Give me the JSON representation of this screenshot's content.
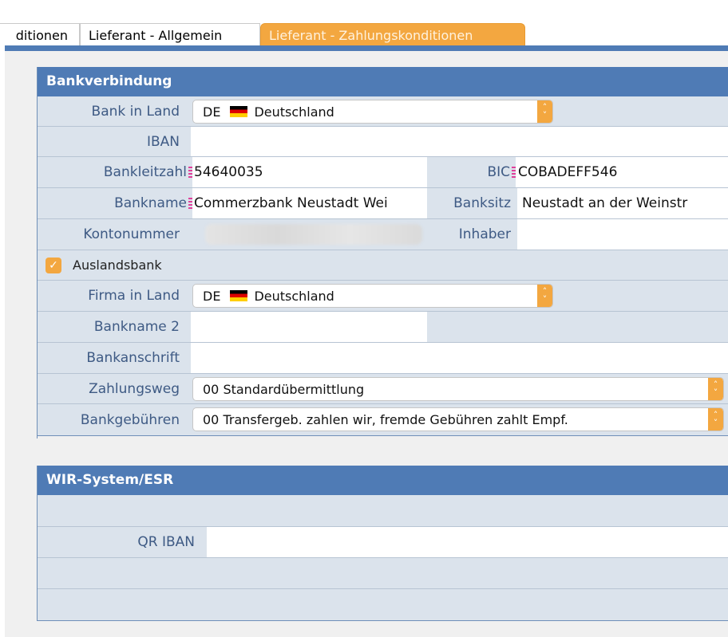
{
  "tabs": [
    {
      "label": "ditionen",
      "active": false
    },
    {
      "label": "Lieferant - Allgemein",
      "active": false
    },
    {
      "label": "Lieferant - Zahlungskonditionen",
      "active": true
    }
  ],
  "colors": {
    "accent": "#f3a740",
    "header": "#4f7bb5",
    "label": "#3e5a84",
    "row": "#dbe3ec"
  },
  "bank_panel": {
    "title": "Bankverbindung",
    "bank_in_land": {
      "label": "Bank in Land",
      "code": "DE",
      "country": "Deutschland"
    },
    "iban": {
      "label": "IBAN",
      "value": ""
    },
    "bankleitzahl": {
      "label": "Bankleitzahl",
      "value": "54640035"
    },
    "bic": {
      "label": "BIC",
      "value": "COBADEFF546"
    },
    "bankname": {
      "label": "Bankname",
      "value": "Commerzbank Neustadt Wei"
    },
    "banksitz": {
      "label": "Banksitz",
      "value": "Neustadt an der Weinstr"
    },
    "kontonummer": {
      "label": "Kontonummer"
    },
    "inhaber": {
      "label": "Inhaber",
      "value": ""
    },
    "auslandsbank": {
      "label": "Auslandsbank",
      "checked": true
    },
    "firma_in_land": {
      "label": "Firma in Land",
      "code": "DE",
      "country": "Deutschland"
    },
    "bankname2": {
      "label": "Bankname 2",
      "value": ""
    },
    "bankanschrift": {
      "label": "Bankanschrift",
      "value": ""
    },
    "zahlungsweg": {
      "label": "Zahlungsweg",
      "value": "00 Standardübermittlung"
    },
    "bankgebuehren": {
      "label": "Bankgebühren",
      "value": "00 Transfergeb. zahlen wir, fremde Gebühren zahlt Empf."
    }
  },
  "wir_panel": {
    "title": "WIR-System/ESR",
    "qr_iban": {
      "label": "QR IBAN",
      "value": ""
    }
  }
}
